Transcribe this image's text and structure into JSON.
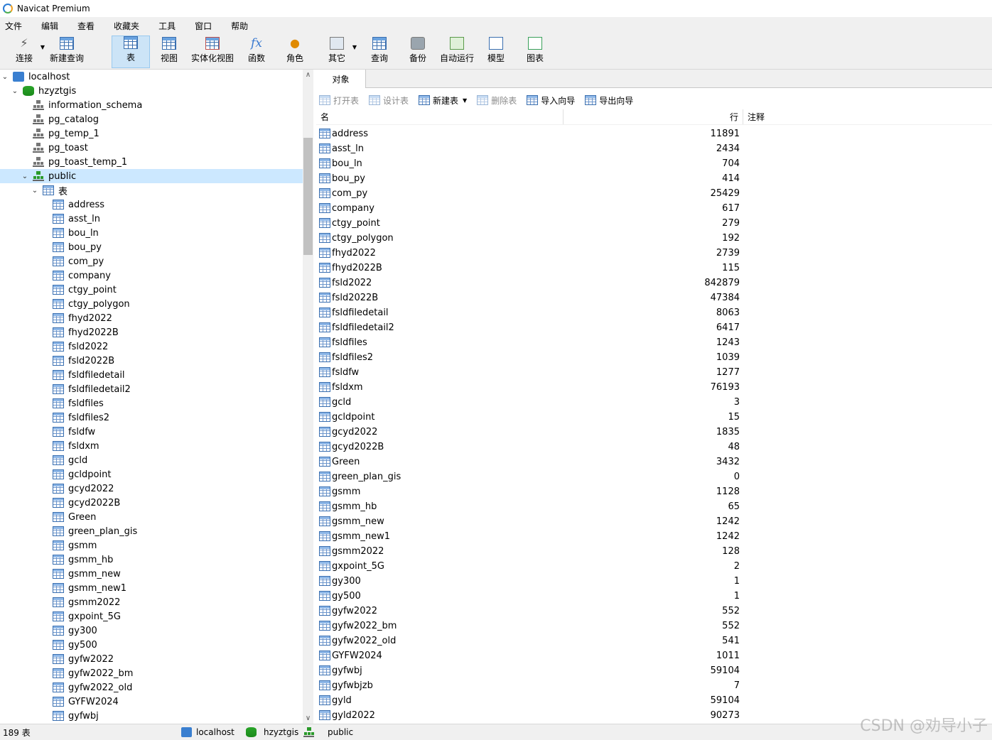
{
  "window": {
    "title": "Navicat Premium"
  },
  "menu": [
    "文件",
    "编辑",
    "查看",
    "收藏夹",
    "工具",
    "窗口",
    "帮助"
  ],
  "toolbar": {
    "connect": "连接",
    "new_query": "新建查询",
    "table": "表",
    "view": "视图",
    "mat_view": "实体化视图",
    "function": "函数",
    "role": "角色",
    "other": "其它",
    "query": "查询",
    "backup": "备份",
    "auto_run": "自动运行",
    "model": "模型",
    "chart": "图表"
  },
  "tree": {
    "connection": "localhost",
    "database": "hzyztgis",
    "schemas": [
      "information_schema",
      "pg_catalog",
      "pg_temp_1",
      "pg_toast",
      "pg_toast_temp_1"
    ],
    "selected_schema": "public",
    "tables_node": "表",
    "tables": [
      "address",
      "asst_ln",
      "bou_ln",
      "bou_py",
      "com_py",
      "company",
      "ctgy_point",
      "ctgy_polygon",
      "fhyd2022",
      "fhyd2022B",
      "fsld2022",
      "fsld2022B",
      "fsldfiledetail",
      "fsldfiledetail2",
      "fsldfiles",
      "fsldfiles2",
      "fsldfw",
      "fsldxm",
      "gcld",
      "gcldpoint",
      "gcyd2022",
      "gcyd2022B",
      "Green",
      "green_plan_gis",
      "gsmm",
      "gsmm_hb",
      "gsmm_new",
      "gsmm_new1",
      "gsmm2022",
      "gxpoint_5G",
      "gy300",
      "gy500",
      "gyfw2022",
      "gyfw2022_bm",
      "gyfw2022_old",
      "GYFW2024",
      "gyfwbj"
    ]
  },
  "tabs": {
    "objects": "对象"
  },
  "objbar": {
    "open": "打开表",
    "design": "设计表",
    "new": "新建表",
    "delete": "删除表",
    "import": "导入向导",
    "export": "导出向导"
  },
  "grid": {
    "headers": {
      "name": "名",
      "rows": "行",
      "comment": "注释"
    },
    "rows": [
      [
        "address",
        "11891"
      ],
      [
        "asst_ln",
        "2434"
      ],
      [
        "bou_ln",
        "704"
      ],
      [
        "bou_py",
        "414"
      ],
      [
        "com_py",
        "25429"
      ],
      [
        "company",
        "617"
      ],
      [
        "ctgy_point",
        "279"
      ],
      [
        "ctgy_polygon",
        "192"
      ],
      [
        "fhyd2022",
        "2739"
      ],
      [
        "fhyd2022B",
        "115"
      ],
      [
        "fsld2022",
        "842879"
      ],
      [
        "fsld2022B",
        "47384"
      ],
      [
        "fsldfiledetail",
        "8063"
      ],
      [
        "fsldfiledetail2",
        "6417"
      ],
      [
        "fsldfiles",
        "1243"
      ],
      [
        "fsldfiles2",
        "1039"
      ],
      [
        "fsldfw",
        "1277"
      ],
      [
        "fsldxm",
        "76193"
      ],
      [
        "gcld",
        "3"
      ],
      [
        "gcldpoint",
        "15"
      ],
      [
        "gcyd2022",
        "1835"
      ],
      [
        "gcyd2022B",
        "48"
      ],
      [
        "Green",
        "3432"
      ],
      [
        "green_plan_gis",
        "0"
      ],
      [
        "gsmm",
        "1128"
      ],
      [
        "gsmm_hb",
        "65"
      ],
      [
        "gsmm_new",
        "1242"
      ],
      [
        "gsmm_new1",
        "1242"
      ],
      [
        "gsmm2022",
        "128"
      ],
      [
        "gxpoint_5G",
        "2"
      ],
      [
        "gy300",
        "1"
      ],
      [
        "gy500",
        "1"
      ],
      [
        "gyfw2022",
        "552"
      ],
      [
        "gyfw2022_bm",
        "552"
      ],
      [
        "gyfw2022_old",
        "541"
      ],
      [
        "GYFW2024",
        "1011"
      ],
      [
        "gyfwbj",
        "59104"
      ],
      [
        "gyfwbjzb",
        "7"
      ],
      [
        "gyld",
        "59104"
      ],
      [
        "gyld2022",
        "90273"
      ]
    ]
  },
  "status": {
    "count": "189 表",
    "connection": "localhost",
    "database": "hzyztgis",
    "schema": "public"
  },
  "watermark": "CSDN @劝导小子"
}
